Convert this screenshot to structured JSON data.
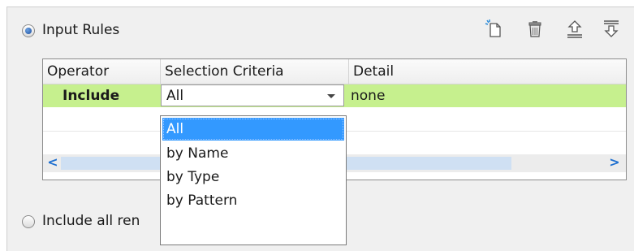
{
  "panel": {
    "input_rules_label": "Input Rules",
    "include_all_label": "Include all ren"
  },
  "toolbar": {
    "icons": [
      "new-rule-icon",
      "delete-icon",
      "move-up-icon",
      "move-down-icon"
    ]
  },
  "table": {
    "columns": [
      "Operator",
      "Selection Criteria",
      "Detail"
    ],
    "rows": [
      {
        "operator": "Include",
        "criteria": "All",
        "detail": "none"
      }
    ],
    "scroll_left": "<",
    "scroll_right": ">"
  },
  "dropdown": {
    "options": [
      "All",
      "by Name",
      "by Type",
      "by Pattern"
    ],
    "selected": "All"
  },
  "colors": {
    "row_highlight": "#c6f08e",
    "selection": "#3399ff",
    "scroll_track": "#cfe0f3"
  }
}
